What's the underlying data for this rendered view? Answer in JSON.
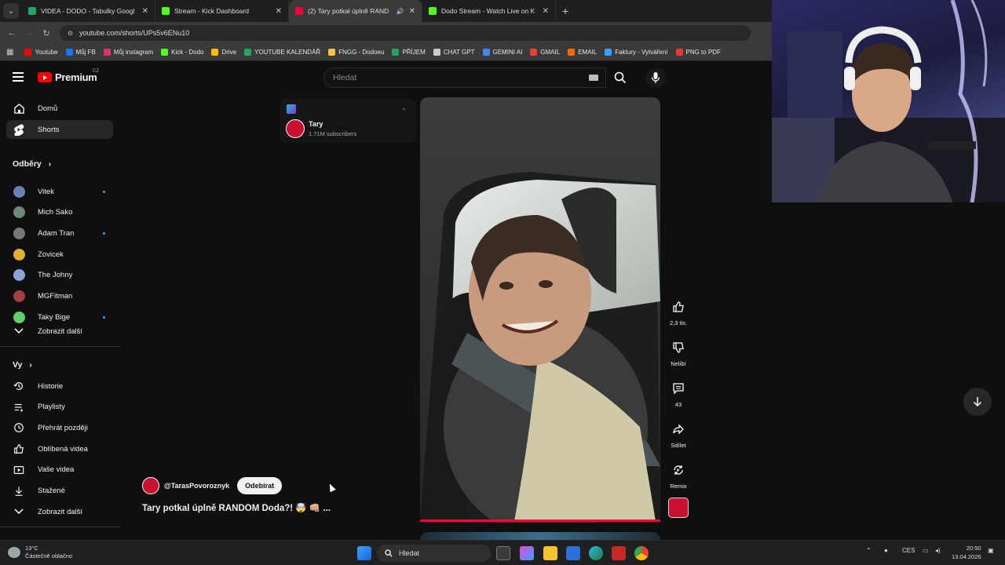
{
  "browser": {
    "tabs": [
      {
        "title": "VIDEA - DODO - Tabulky Googl",
        "color": "#22a565"
      },
      {
        "title": "Stream - Kick Dashboard",
        "color": "#53fc18"
      },
      {
        "title": "(2) Tary potkal úplně RAND",
        "color": "#ff0033"
      },
      {
        "title": "Dodo Stream - Watch Live on K",
        "color": "#53fc18"
      }
    ],
    "url": "youtube.com/shorts/UPs5v6ENu10",
    "bookmarks": [
      {
        "label": "Youtube",
        "color": "#ff0000"
      },
      {
        "label": "Můj FB",
        "color": "#1877f2"
      },
      {
        "label": "Můj instagram",
        "color": "#e1306c"
      },
      {
        "label": "Kick - Dodo",
        "color": "#53fc18"
      },
      {
        "label": "Drive",
        "color": "#fbbc04"
      },
      {
        "label": "YOUTUBE KALENDÁŘ",
        "color": "#22a565"
      },
      {
        "label": "FNGG - Dodoeu",
        "color": "#f5c542"
      },
      {
        "label": "PŘÍJEM",
        "color": "#22a565"
      },
      {
        "label": "CHAT GPT",
        "color": "#cccccc"
      },
      {
        "label": "GEMINI AI",
        "color": "#4285f4"
      },
      {
        "label": "GMAIL",
        "color": "#ea4335"
      },
      {
        "label": "EMAIL",
        "color": "#ff6600"
      },
      {
        "label": "Faktury - Vytváření",
        "color": "#3aa0ff"
      },
      {
        "label": "PNG to PDF",
        "color": "#e53935"
      }
    ]
  },
  "header": {
    "logo": "Premium",
    "region": "CZ",
    "search_placeholder": "Hledat"
  },
  "sidebar": {
    "main": [
      {
        "label": "Domů",
        "icon": "home-icon"
      },
      {
        "label": "Shorts",
        "icon": "shorts-icon"
      }
    ],
    "subscriptions_title": "Odběry",
    "subscriptions": [
      {
        "label": "Vitek",
        "color": "#6a7fb5",
        "dot": true
      },
      {
        "label": "Mich Sako",
        "color": "#6e8a74",
        "dot": false
      },
      {
        "label": "Adam Tran",
        "color": "#777777",
        "dot": true
      },
      {
        "label": "Zovicek",
        "color": "#e0b030",
        "dot": false
      },
      {
        "label": "The Johny",
        "color": "#8aa3d6",
        "dot": false
      },
      {
        "label": "MGFitman",
        "color": "#a04040",
        "dot": false
      },
      {
        "label": "Taky Bige",
        "color": "#5fcf6a",
        "dot": true
      }
    ],
    "subs_more": "Zobrazit další",
    "you_title": "Vy",
    "you": [
      {
        "label": "Historie",
        "icon": "history-icon"
      },
      {
        "label": "Playlisty",
        "icon": "playlist-icon"
      },
      {
        "label": "Přehrát později",
        "icon": "clock-icon"
      },
      {
        "label": "Oblíbená videa",
        "icon": "like-icon"
      },
      {
        "label": "Vaše videa",
        "icon": "video-icon"
      },
      {
        "label": "Stažené",
        "icon": "download-icon"
      }
    ],
    "you_more": "Zobrazit další"
  },
  "channel_card": {
    "name": "Tary",
    "subscribers": "1.71M subscribers"
  },
  "short": {
    "owner": "@TarasPovoroznyk",
    "subscribe": "Odebírat",
    "title": "Tary potkal úplně RANDOM Doda?! 🤯 👊🏼 ...",
    "progress": 1.0
  },
  "actions": {
    "likes": "2,3 tis.",
    "dislike": "Nelíbí",
    "comments": "43",
    "share": "Sdílet",
    "remix": "Remix"
  },
  "taskbar": {
    "temp": "13°C",
    "weather": "Částečně oblačno",
    "search": "Hledat",
    "lang": "CES",
    "time": "20:50",
    "date": "13.04.2026"
  }
}
